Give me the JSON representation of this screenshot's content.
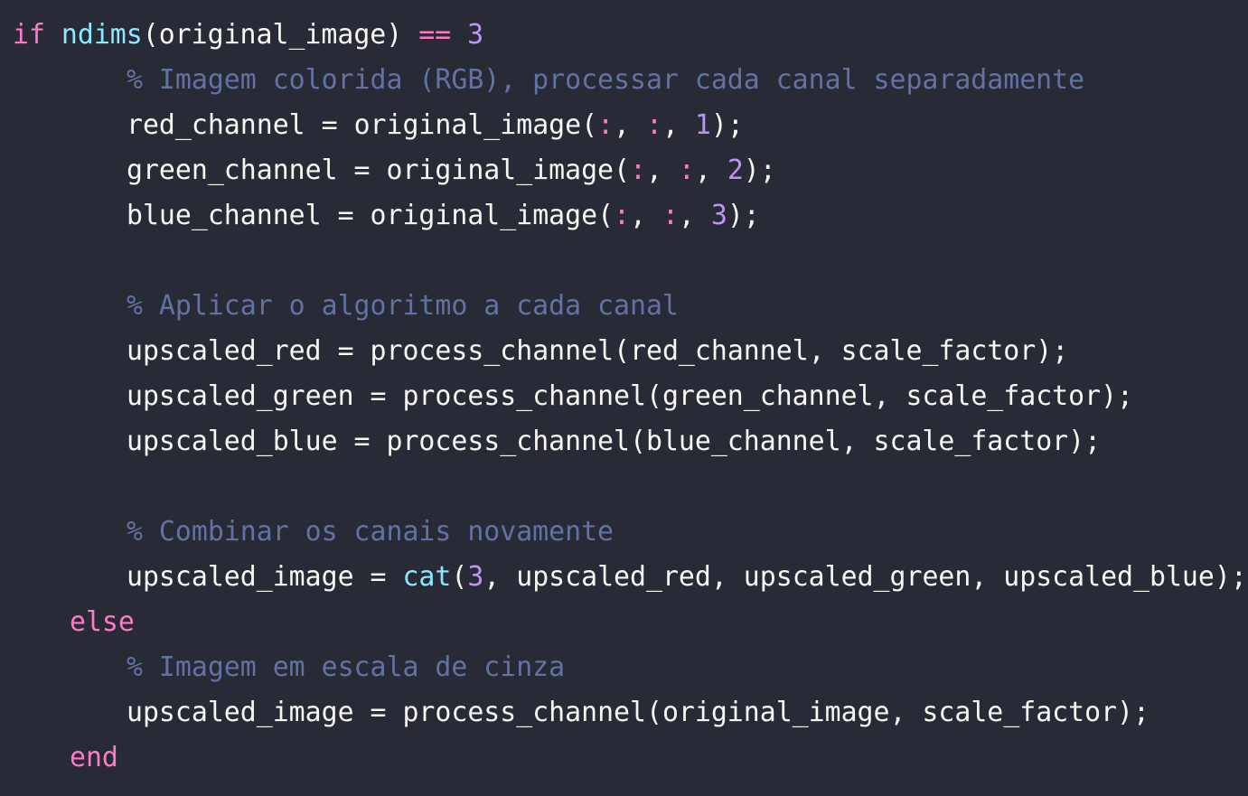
{
  "editor": {
    "language": "MATLAB",
    "theme_colors": {
      "background": "#282a36",
      "foreground": "#f8f8f2",
      "keyword": "#ff79c6",
      "builtin": "#8be9fd",
      "comment": "#6272a4",
      "number": "#bd93f9"
    },
    "lines": [
      {
        "indent": 0,
        "tokens": [
          {
            "t": "keyword",
            "v": "if"
          },
          {
            "t": "text",
            "v": " "
          },
          {
            "t": "builtin",
            "v": "ndims"
          },
          {
            "t": "punct",
            "v": "("
          },
          {
            "t": "ident",
            "v": "original_image"
          },
          {
            "t": "punct",
            "v": ")"
          },
          {
            "t": "text",
            "v": " "
          },
          {
            "t": "operator",
            "v": "=="
          },
          {
            "t": "text",
            "v": " "
          },
          {
            "t": "number",
            "v": "3"
          }
        ]
      },
      {
        "indent": 2,
        "tokens": [
          {
            "t": "comment",
            "v": "% Imagem colorida (RGB), processar cada canal separadamente"
          }
        ]
      },
      {
        "indent": 2,
        "tokens": [
          {
            "t": "ident",
            "v": "red_channel"
          },
          {
            "t": "text",
            "v": " = "
          },
          {
            "t": "ident",
            "v": "original_image"
          },
          {
            "t": "punct",
            "v": "("
          },
          {
            "t": "colon",
            "v": ":"
          },
          {
            "t": "punct",
            "v": ", "
          },
          {
            "t": "colon",
            "v": ":"
          },
          {
            "t": "punct",
            "v": ", "
          },
          {
            "t": "number",
            "v": "1"
          },
          {
            "t": "punct",
            "v": ");"
          }
        ]
      },
      {
        "indent": 2,
        "tokens": [
          {
            "t": "ident",
            "v": "green_channel"
          },
          {
            "t": "text",
            "v": " = "
          },
          {
            "t": "ident",
            "v": "original_image"
          },
          {
            "t": "punct",
            "v": "("
          },
          {
            "t": "colon",
            "v": ":"
          },
          {
            "t": "punct",
            "v": ", "
          },
          {
            "t": "colon",
            "v": ":"
          },
          {
            "t": "punct",
            "v": ", "
          },
          {
            "t": "number",
            "v": "2"
          },
          {
            "t": "punct",
            "v": ");"
          }
        ]
      },
      {
        "indent": 2,
        "tokens": [
          {
            "t": "ident",
            "v": "blue_channel"
          },
          {
            "t": "text",
            "v": " = "
          },
          {
            "t": "ident",
            "v": "original_image"
          },
          {
            "t": "punct",
            "v": "("
          },
          {
            "t": "colon",
            "v": ":"
          },
          {
            "t": "punct",
            "v": ", "
          },
          {
            "t": "colon",
            "v": ":"
          },
          {
            "t": "punct",
            "v": ", "
          },
          {
            "t": "number",
            "v": "3"
          },
          {
            "t": "punct",
            "v": ");"
          }
        ]
      },
      {
        "indent": 0,
        "tokens": []
      },
      {
        "indent": 2,
        "tokens": [
          {
            "t": "comment",
            "v": "% Aplicar o algoritmo a cada canal"
          }
        ]
      },
      {
        "indent": 2,
        "tokens": [
          {
            "t": "ident",
            "v": "upscaled_red"
          },
          {
            "t": "text",
            "v": " = "
          },
          {
            "t": "ident",
            "v": "process_channel"
          },
          {
            "t": "punct",
            "v": "("
          },
          {
            "t": "ident",
            "v": "red_channel"
          },
          {
            "t": "punct",
            "v": ", "
          },
          {
            "t": "ident",
            "v": "scale_factor"
          },
          {
            "t": "punct",
            "v": ");"
          }
        ]
      },
      {
        "indent": 2,
        "tokens": [
          {
            "t": "ident",
            "v": "upscaled_green"
          },
          {
            "t": "text",
            "v": " = "
          },
          {
            "t": "ident",
            "v": "process_channel"
          },
          {
            "t": "punct",
            "v": "("
          },
          {
            "t": "ident",
            "v": "green_channel"
          },
          {
            "t": "punct",
            "v": ", "
          },
          {
            "t": "ident",
            "v": "scale_factor"
          },
          {
            "t": "punct",
            "v": ");"
          }
        ]
      },
      {
        "indent": 2,
        "tokens": [
          {
            "t": "ident",
            "v": "upscaled_blue"
          },
          {
            "t": "text",
            "v": " = "
          },
          {
            "t": "ident",
            "v": "process_channel"
          },
          {
            "t": "punct",
            "v": "("
          },
          {
            "t": "ident",
            "v": "blue_channel"
          },
          {
            "t": "punct",
            "v": ", "
          },
          {
            "t": "ident",
            "v": "scale_factor"
          },
          {
            "t": "punct",
            "v": ");"
          }
        ]
      },
      {
        "indent": 0,
        "tokens": []
      },
      {
        "indent": 2,
        "tokens": [
          {
            "t": "comment",
            "v": "% Combinar os canais novamente"
          }
        ]
      },
      {
        "indent": 2,
        "tokens": [
          {
            "t": "ident",
            "v": "upscaled_image"
          },
          {
            "t": "text",
            "v": " = "
          },
          {
            "t": "builtin",
            "v": "cat"
          },
          {
            "t": "punct",
            "v": "("
          },
          {
            "t": "number",
            "v": "3"
          },
          {
            "t": "punct",
            "v": ", "
          },
          {
            "t": "ident",
            "v": "upscaled_red"
          },
          {
            "t": "punct",
            "v": ", "
          },
          {
            "t": "ident",
            "v": "upscaled_green"
          },
          {
            "t": "punct",
            "v": ", "
          },
          {
            "t": "ident",
            "v": "upscaled_blue"
          },
          {
            "t": "punct",
            "v": ");"
          }
        ]
      },
      {
        "indent": 1,
        "tokens": [
          {
            "t": "keyword",
            "v": "else"
          }
        ]
      },
      {
        "indent": 2,
        "tokens": [
          {
            "t": "comment",
            "v": "% Imagem em escala de cinza"
          }
        ]
      },
      {
        "indent": 2,
        "tokens": [
          {
            "t": "ident",
            "v": "upscaled_image"
          },
          {
            "t": "text",
            "v": " = "
          },
          {
            "t": "ident",
            "v": "process_channel"
          },
          {
            "t": "punct",
            "v": "("
          },
          {
            "t": "ident",
            "v": "original_image"
          },
          {
            "t": "punct",
            "v": ", "
          },
          {
            "t": "ident",
            "v": "scale_factor"
          },
          {
            "t": "punct",
            "v": ");"
          }
        ]
      },
      {
        "indent": 1,
        "tokens": [
          {
            "t": "keyword",
            "v": "end"
          }
        ]
      }
    ]
  }
}
